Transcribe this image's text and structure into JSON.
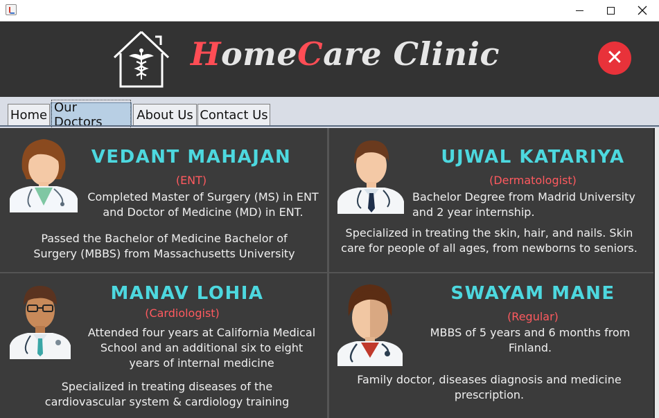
{
  "window": {
    "minimize_glyph": "—",
    "maximize_glyph": "☐",
    "close_glyph": "✕"
  },
  "header": {
    "brand_part1_highlight": "H",
    "brand_part1_rest": "ome",
    "brand_part2_highlight": "C",
    "brand_part2_rest": "are Clinic",
    "exit_glyph": "✕",
    "colors": {
      "banner": "#333333",
      "accent_red": "#ff4d55",
      "exit_red": "#e8323a"
    }
  },
  "tabs": [
    {
      "label": "Home"
    },
    {
      "label": "Our Doctors",
      "active": true
    },
    {
      "label": "About Us"
    },
    {
      "label": "Contact Us"
    }
  ],
  "doctors": [
    {
      "name": "VEDANT MAHAJAN",
      "specialty": "(ENT)",
      "line1": "Completed Master of Surgery (MS) in ENT",
      "line2": "and Doctor of Medicine (MD) in ENT.",
      "extra1": "Passed the Bachelor of Medicine Bachelor of",
      "extra2": "Surgery (MBBS) from Massachusetts University",
      "avatar_icon": "doctor-female-avatar-icon"
    },
    {
      "name": "UJWAL KATARIYA",
      "specialty": "(Dermatologist)",
      "line1": "Bachelor Degree from Madrid University",
      "line2": "and 2 year internship.",
      "extra1": "Specialized in treating the skin, hair, and nails. Skin",
      "extra2": "care for people of all ages, from newborns to seniors.",
      "avatar_icon": "doctor-male-avatar-icon"
    },
    {
      "name": "MANAV LOHIA",
      "specialty": "(Cardiologist)",
      "line1": "Attended four years at California Medical",
      "line2": "School and an additional six to eight",
      "line3": "years of internal medicine",
      "extra1": "Specialized in treating diseases of the",
      "extra2": "cardiovascular system & cardiology training",
      "avatar_icon": "doctor-glasses-avatar-icon"
    },
    {
      "name": "SWAYAM MANE",
      "specialty": "(Regular)",
      "line1": "MBBS of 5 years and 6 months from",
      "line2": "Finland.",
      "extra1": "Family doctor, diseases diagnosis and medicine",
      "extra2": "prescription.",
      "avatar_icon": "doctor-cartoon-avatar-icon"
    }
  ],
  "colors": {
    "name_cyan": "#4dd8df",
    "specialty_red": "#ff5a5f",
    "card_bg": "#3b3b3b"
  }
}
